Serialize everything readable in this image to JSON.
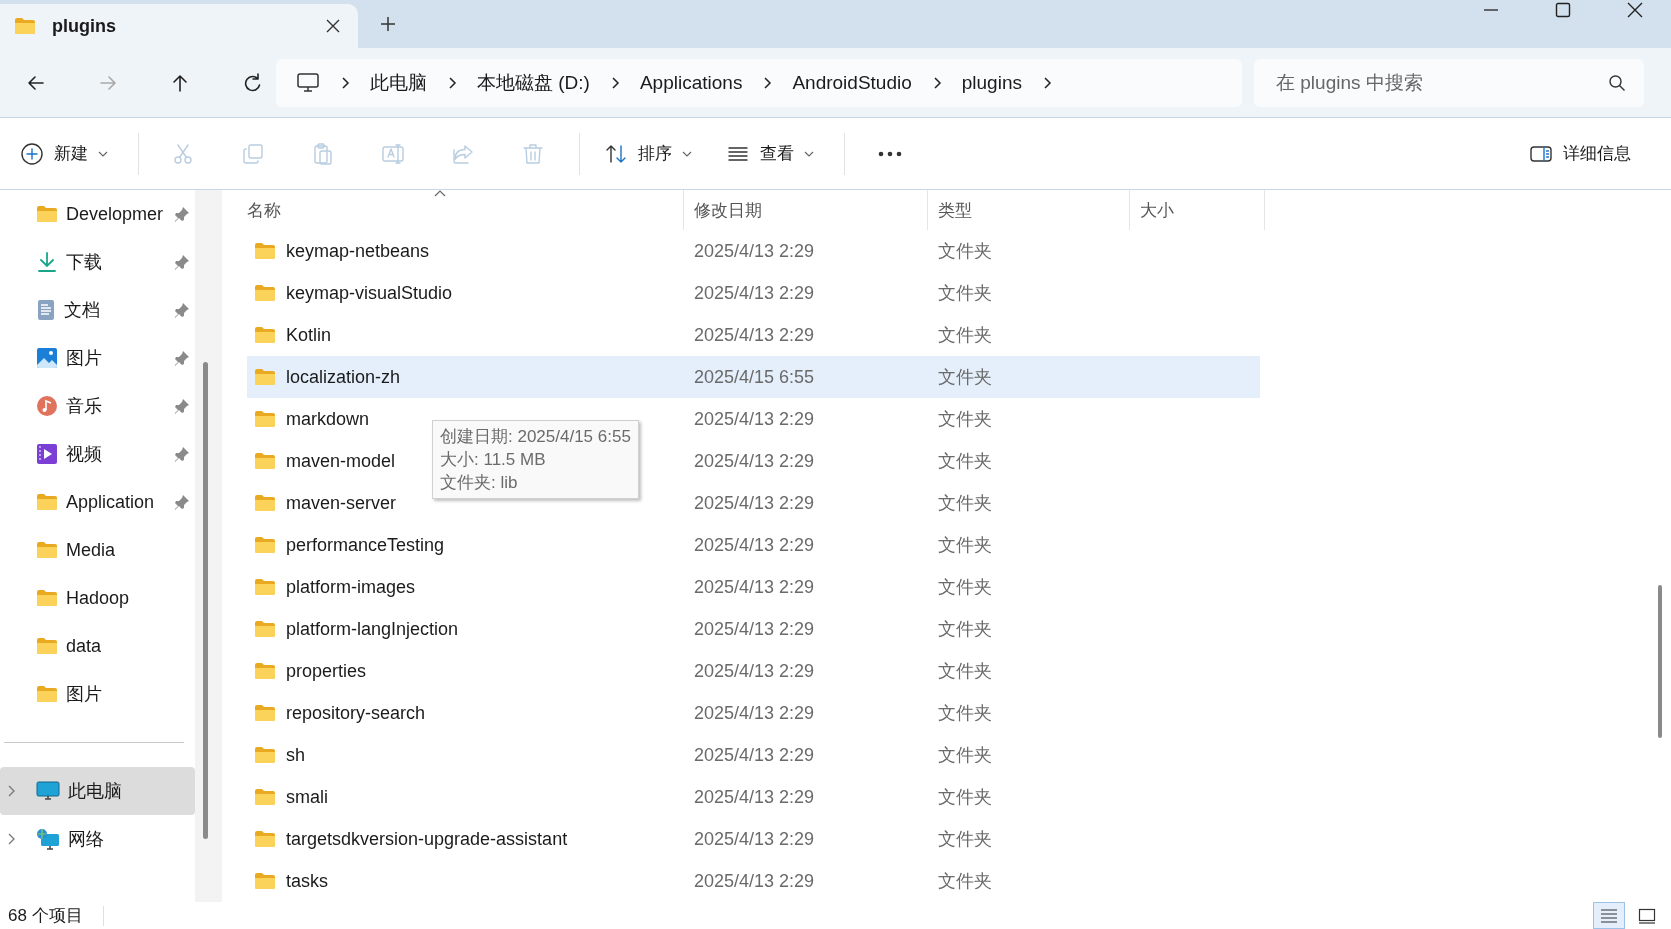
{
  "tabs": [
    {
      "title": "plugins",
      "selected": true
    }
  ],
  "nav": [
    {
      "kind": "back",
      "disabled": false
    },
    {
      "kind": "forward",
      "disabled": true
    },
    {
      "kind": "up",
      "disabled": false
    },
    {
      "kind": "refresh",
      "disabled": false
    }
  ],
  "breadcrumb": {
    "items": [
      "此电脑",
      "本地磁盘 (D:)",
      "Applications",
      "AndroidStudio",
      "plugins"
    ]
  },
  "search": {
    "placeholder": "在 plugins 中搜索"
  },
  "toolbar": [
    {
      "kind": "new",
      "label": "新建",
      "dropdown": true,
      "disabled": false
    },
    {
      "kind": "separator"
    },
    {
      "kind": "cut",
      "disabled": true
    },
    {
      "kind": "copy",
      "disabled": true
    },
    {
      "kind": "paste",
      "disabled": true
    },
    {
      "kind": "rename",
      "disabled": true
    },
    {
      "kind": "share",
      "disabled": true
    },
    {
      "kind": "delete",
      "disabled": true
    },
    {
      "kind": "separator"
    },
    {
      "kind": "sort",
      "label": "排序",
      "dropdown": true,
      "disabled": false
    },
    {
      "kind": "view",
      "label": "查看",
      "dropdown": true,
      "disabled": false
    },
    {
      "kind": "separator"
    },
    {
      "kind": "more",
      "disabled": false
    },
    {
      "kind": "details",
      "label": "详细信息",
      "disabled": false
    }
  ],
  "sidebar": {
    "items": [
      {
        "kind": "folder",
        "label": "Developmer",
        "pinned": true,
        "selected": false
      },
      {
        "kind": "download",
        "label": "下载",
        "pinned": true,
        "selected": false
      },
      {
        "kind": "documents",
        "label": "文档",
        "pinned": true,
        "selected": false
      },
      {
        "kind": "pictures",
        "label": "图片",
        "pinned": true,
        "selected": false
      },
      {
        "kind": "music",
        "label": "音乐",
        "pinned": true,
        "selected": false
      },
      {
        "kind": "video",
        "label": "视频",
        "pinned": true,
        "selected": false
      },
      {
        "kind": "folder",
        "label": "Application",
        "pinned": true,
        "selected": false
      },
      {
        "kind": "folder",
        "label": "Media",
        "pinned": false,
        "selected": false
      },
      {
        "kind": "folder",
        "label": "Hadoop",
        "pinned": false,
        "selected": false
      },
      {
        "kind": "folder",
        "label": "data",
        "pinned": false,
        "selected": false
      },
      {
        "kind": "folder",
        "label": "图片",
        "pinned": false,
        "selected": false
      }
    ],
    "locations": [
      {
        "kind": "computer",
        "label": "此电脑",
        "selected": true
      },
      {
        "kind": "network",
        "label": "网络",
        "selected": false
      }
    ]
  },
  "table": {
    "columns": [
      "名称",
      "修改日期",
      "类型",
      "大小"
    ],
    "rows": [
      {
        "name": "keymap-netbeans",
        "date": "2025/4/13 2:29",
        "type": "文件夹",
        "selected": false
      },
      {
        "name": "keymap-visualStudio",
        "date": "2025/4/13 2:29",
        "type": "文件夹",
        "selected": false
      },
      {
        "name": "Kotlin",
        "date": "2025/4/13 2:29",
        "type": "文件夹",
        "selected": false
      },
      {
        "name": "localization-zh",
        "date": "2025/4/15 6:55",
        "type": "文件夹",
        "selected": true
      },
      {
        "name": "markdown",
        "date": "2025/4/13 2:29",
        "type": "文件夹",
        "selected": false
      },
      {
        "name": "maven-model",
        "date": "2025/4/13 2:29",
        "type": "文件夹",
        "selected": false
      },
      {
        "name": "maven-server",
        "date": "2025/4/13 2:29",
        "type": "文件夹",
        "selected": false
      },
      {
        "name": "performanceTesting",
        "date": "2025/4/13 2:29",
        "type": "文件夹",
        "selected": false
      },
      {
        "name": "platform-images",
        "date": "2025/4/13 2:29",
        "type": "文件夹",
        "selected": false
      },
      {
        "name": "platform-langInjection",
        "date": "2025/4/13 2:29",
        "type": "文件夹",
        "selected": false
      },
      {
        "name": "properties",
        "date": "2025/4/13 2:29",
        "type": "文件夹",
        "selected": false
      },
      {
        "name": "repository-search",
        "date": "2025/4/13 2:29",
        "type": "文件夹",
        "selected": false
      },
      {
        "name": "sh",
        "date": "2025/4/13 2:29",
        "type": "文件夹",
        "selected": false
      },
      {
        "name": "smali",
        "date": "2025/4/13 2:29",
        "type": "文件夹",
        "selected": false
      },
      {
        "name": "targetsdkversion-upgrade-assistant",
        "date": "2025/4/13 2:29",
        "type": "文件夹",
        "selected": false
      },
      {
        "name": "tasks",
        "date": "2025/4/13 2:29",
        "type": "文件夹",
        "selected": false
      }
    ]
  },
  "tooltip": {
    "lines": [
      "创建日期: 2025/4/15 6:55",
      "大小: 11.5 MB",
      "文件夹: lib"
    ]
  },
  "status_bar": {
    "count": "68 个项目",
    "views": [
      {
        "kind": "details",
        "selected": true
      },
      {
        "kind": "tiles",
        "selected": false
      }
    ]
  }
}
